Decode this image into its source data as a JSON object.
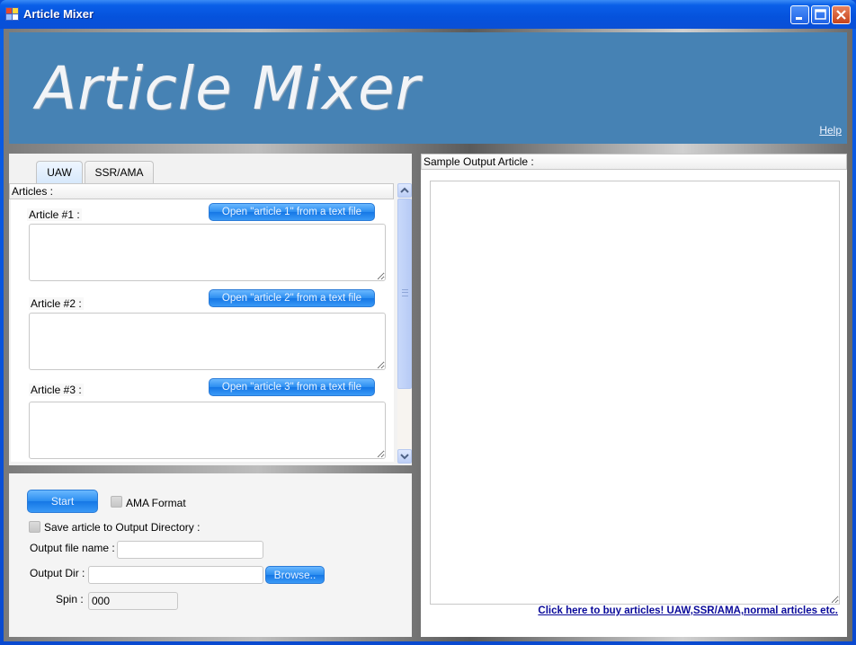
{
  "window": {
    "title": "Article Mixer",
    "controls": [
      "minimize",
      "maximize",
      "close"
    ]
  },
  "banner": {
    "title": "Article Mixer",
    "help_link": "Help",
    "background_color": "#4682b4"
  },
  "tabs": [
    {
      "label": "UAW",
      "active": true
    },
    {
      "label": "SSR/AMA",
      "active": false
    }
  ],
  "articles": {
    "header": "Articles :",
    "items": [
      {
        "label": "Article #1 :",
        "open_button": "Open \"article 1\" from a text file",
        "value": ""
      },
      {
        "label": "Article #2 :",
        "open_button": "Open \"article 2\" from a text file",
        "value": ""
      },
      {
        "label": "Article #3 :",
        "open_button": "Open \"article 3\" from a text file",
        "value": ""
      }
    ]
  },
  "controls": {
    "start_button": "Start",
    "ama_format_label": "AMA Format",
    "ama_format_checked": false,
    "save_to_dir_label": "Save article to Output Directory :",
    "save_to_dir_checked": false,
    "output_file_label": "Output file name :",
    "output_file_value": "",
    "output_dir_label": "Output Dir :",
    "output_dir_value": "",
    "browse_button": "Browse..",
    "spin_label": "Spin :",
    "spin_value": "000"
  },
  "output": {
    "header": "Sample Output Article :",
    "value": "",
    "buy_link": "Click here to buy articles! UAW,SSR/AMA,normal articles etc."
  },
  "colors": {
    "accent_button": "#2a8df0",
    "titlebar": "#0552dc",
    "link": "#0a0a9a"
  }
}
